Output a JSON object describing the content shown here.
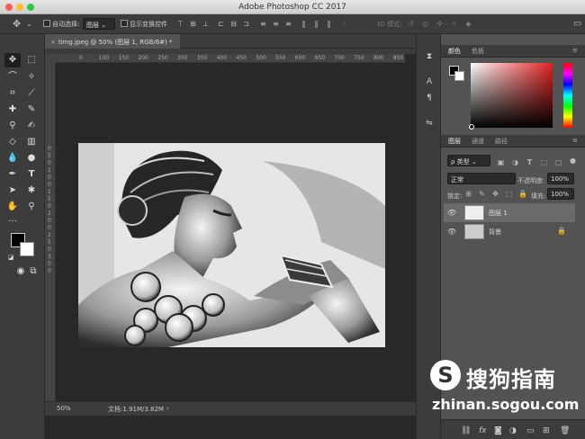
{
  "app": {
    "title": "Adobe Photoshop CC 2017"
  },
  "options": {
    "auto_select": "自动选择:",
    "layer_select": "图层",
    "show_transform": "显示变换控件",
    "mode_3d": "3D 模式:"
  },
  "document": {
    "tab_title": "timg.jpeg @ 50% (图层 1, RGB/8#) *",
    "zoom": "50%",
    "doc_info": "文档:1.91M/3.82M"
  },
  "ruler_top": [
    "0",
    "100",
    "150",
    "200",
    "250",
    "300",
    "350",
    "400",
    "450",
    "500",
    "550",
    "600",
    "650",
    "700",
    "750",
    "800",
    "850"
  ],
  "ruler_left": [
    "0",
    "5",
    "0",
    "1",
    "0",
    "0",
    "1",
    "5",
    "0",
    "2",
    "0",
    "0",
    "2",
    "5",
    "0",
    "3",
    "0",
    "0"
  ],
  "panels": {
    "color_tabs": [
      "颜色",
      "色板"
    ],
    "layers_tabs": [
      "图层",
      "通道",
      "路径"
    ],
    "kind_filter": "ρ 类型",
    "blend_mode": "正常",
    "opacity_label": "不透明度:",
    "opacity_value": "100%",
    "lock_label": "锁定:",
    "fill_label": "填充:",
    "fill_value": "100%",
    "layers": [
      {
        "name": "图层 1"
      },
      {
        "name": "背景"
      }
    ]
  },
  "colors": {
    "foreground": "#000000",
    "background": "#ffffff"
  },
  "watermark": {
    "brand": "搜狗指南",
    "url": "zhinan.sogou.com"
  }
}
